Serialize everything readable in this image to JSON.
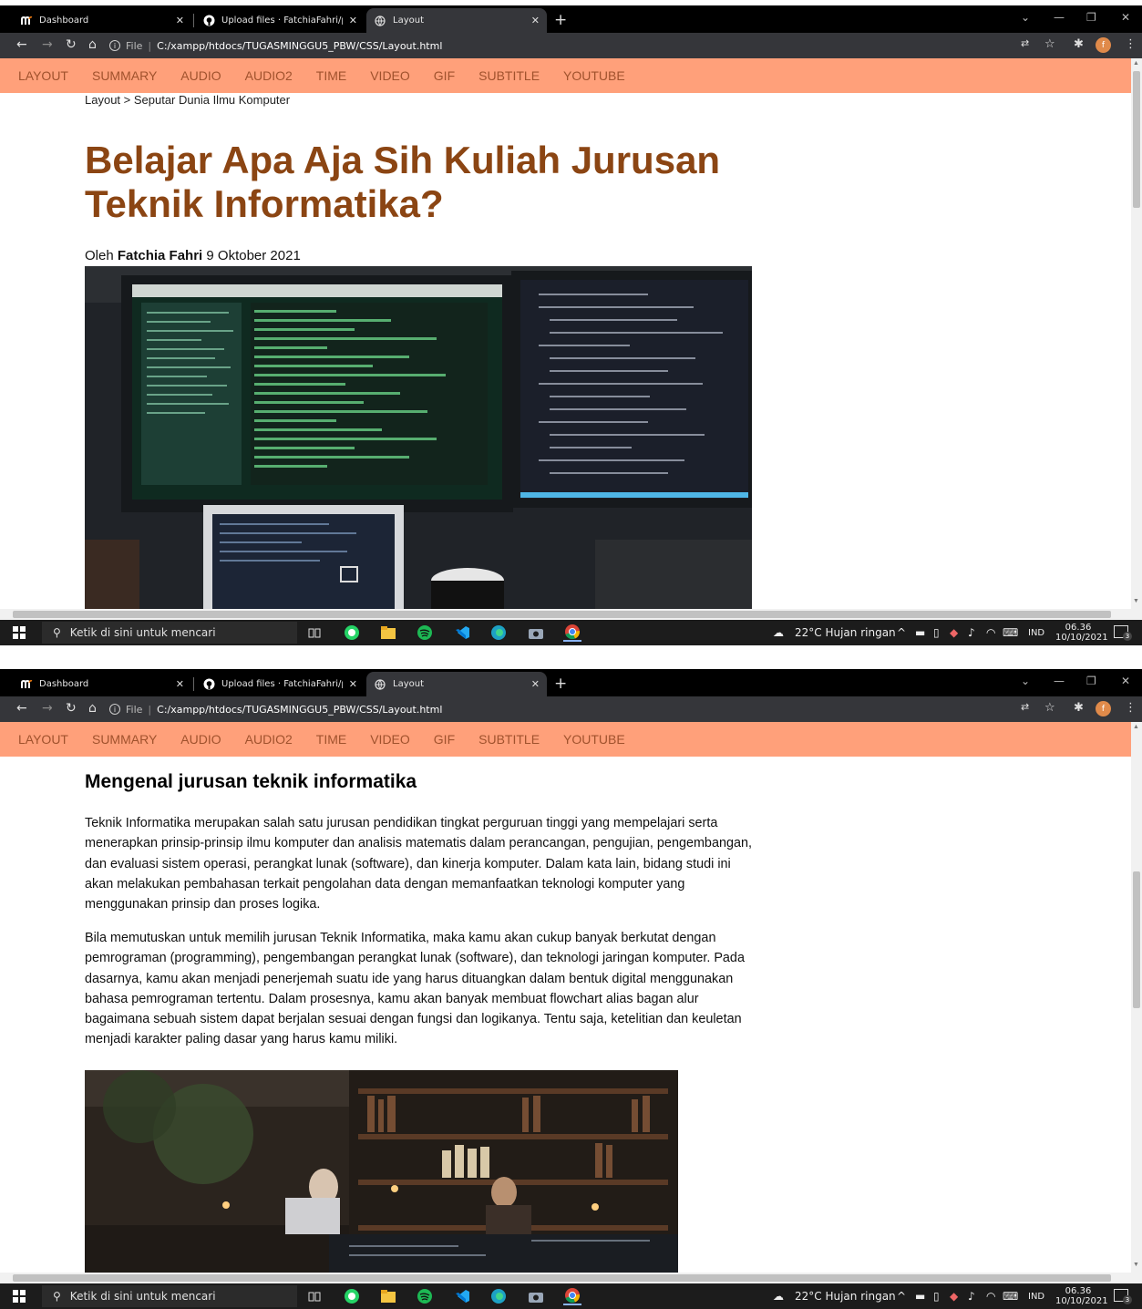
{
  "browser": {
    "tabs": [
      {
        "title": "Dashboard",
        "icon": "moodle-icon"
      },
      {
        "title": "Upload files · FatchiaFahri/pemr",
        "icon": "github-icon"
      },
      {
        "title": "Layout",
        "icon": "globe-icon"
      }
    ],
    "address": {
      "scheme": "File",
      "url": "C:/xampp/htdocs/TUGASMINGGU5_PBW/CSS/Layout.html"
    }
  },
  "nav": {
    "items": [
      "LAYOUT",
      "SUMMARY",
      "AUDIO",
      "AUDIO2",
      "TIME",
      "VIDEO",
      "GIF",
      "SUBTITLE",
      "YOUTUBE"
    ],
    "background": "#ffa07a",
    "link_color": "#a0522d"
  },
  "article": {
    "breadcrumb": "Layout > Seputar Dunia Ilmu Komputer",
    "title": "Belajar Apa Aja Sih Kuliah Jurusan Teknik Informatika?",
    "byline_prefix": "Oleh",
    "author": "Fatchia Fahri",
    "date": "9 Oktober 2021",
    "title_color": "#8b4513",
    "section_heading": "Mengenal jurusan teknik informatika",
    "paragraphs": [
      "Teknik Informatika merupakan salah satu jurusan pendidikan tingkat perguruan tinggi yang mempelajari serta menerapkan prinsip-prinsip ilmu komputer dan analisis matematis dalam perancangan, pengujian, pengembangan, dan evaluasi sistem operasi, perangkat lunak (software), dan kinerja komputer. Dalam kata lain, bidang studi ini akan melakukan pembahasan terkait pengolahan data dengan memanfaatkan teknologi komputer yang menggunakan prinsip dan proses logika.",
      "Bila memutuskan untuk memilih jurusan Teknik Informatika, maka kamu akan cukup banyak berkutat dengan pemrograman (programming), pengembangan perangkat lunak (software), dan teknologi jaringan komputer. Pada dasarnya, kamu akan menjadi penerjemah suatu ide yang harus dituangkan dalam bentuk digital menggunakan bahasa pemrograman tertentu. Dalam prosesnya, kamu akan banyak membuat flowchart alias bagan alur bagaimana sebuah sistem dapat berjalan sesuai dengan fungsi dan logikanya. Tentu saja, ketelitian dan keuletan menjadi karakter paling dasar yang harus kamu miliki."
    ]
  },
  "taskbar": {
    "search_placeholder": "Ketik di sini untuk mencari",
    "weather": "22°C  Hujan ringan",
    "language": "IND",
    "time": "06.36",
    "date": "10/10/2021",
    "notification_count": "3",
    "apps": [
      "task-view-icon",
      "whatsapp-icon",
      "file-explorer-icon",
      "spotify-icon",
      "vscode-icon",
      "edge-icon",
      "camera-icon",
      "chrome-icon"
    ]
  }
}
